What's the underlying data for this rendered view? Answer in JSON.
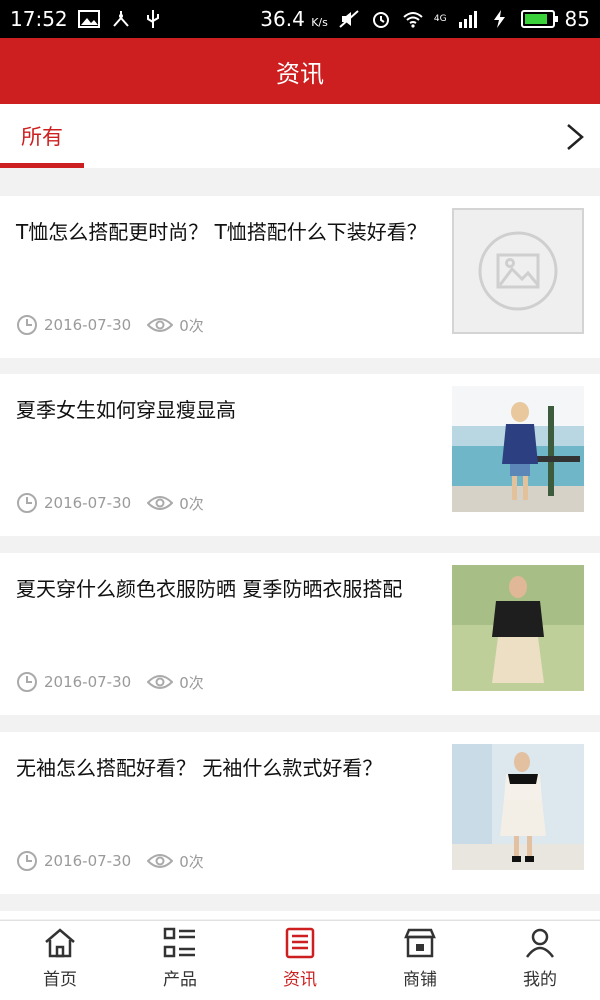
{
  "status": {
    "time": "17:52",
    "speed": "36.4",
    "speed_unit": "K/s",
    "network": "4G",
    "battery": "85"
  },
  "header": {
    "title": "资讯"
  },
  "tabs": {
    "items": [
      {
        "label": "所有"
      }
    ]
  },
  "articles": [
    {
      "title": "T恤怎么搭配更时尚？ T恤搭配什么下装好看？",
      "date": "2016-07-30",
      "views": "0次",
      "thumb": "placeholder"
    },
    {
      "title": "夏季女生如何穿显瘦显高",
      "date": "2016-07-30",
      "views": "0次",
      "thumb": "photo-1"
    },
    {
      "title": "夏天穿什么颜色衣服防晒 夏季防晒衣服搭配",
      "date": "2016-07-30",
      "views": "0次",
      "thumb": "photo-2"
    },
    {
      "title": "无袖怎么搭配好看？ 无袖什么款式好看？",
      "date": "2016-07-30",
      "views": "0次",
      "thumb": "photo-3"
    }
  ],
  "bottom_nav": [
    {
      "label": "首页",
      "icon": "home-icon"
    },
    {
      "label": "产品",
      "icon": "grid-list-icon"
    },
    {
      "label": "资讯",
      "icon": "news-icon",
      "active": true
    },
    {
      "label": "商铺",
      "icon": "shop-icon"
    },
    {
      "label": "我的",
      "icon": "user-icon"
    }
  ],
  "colors": {
    "accent": "#cd1f1f",
    "meta_text": "#9a9a9a"
  }
}
